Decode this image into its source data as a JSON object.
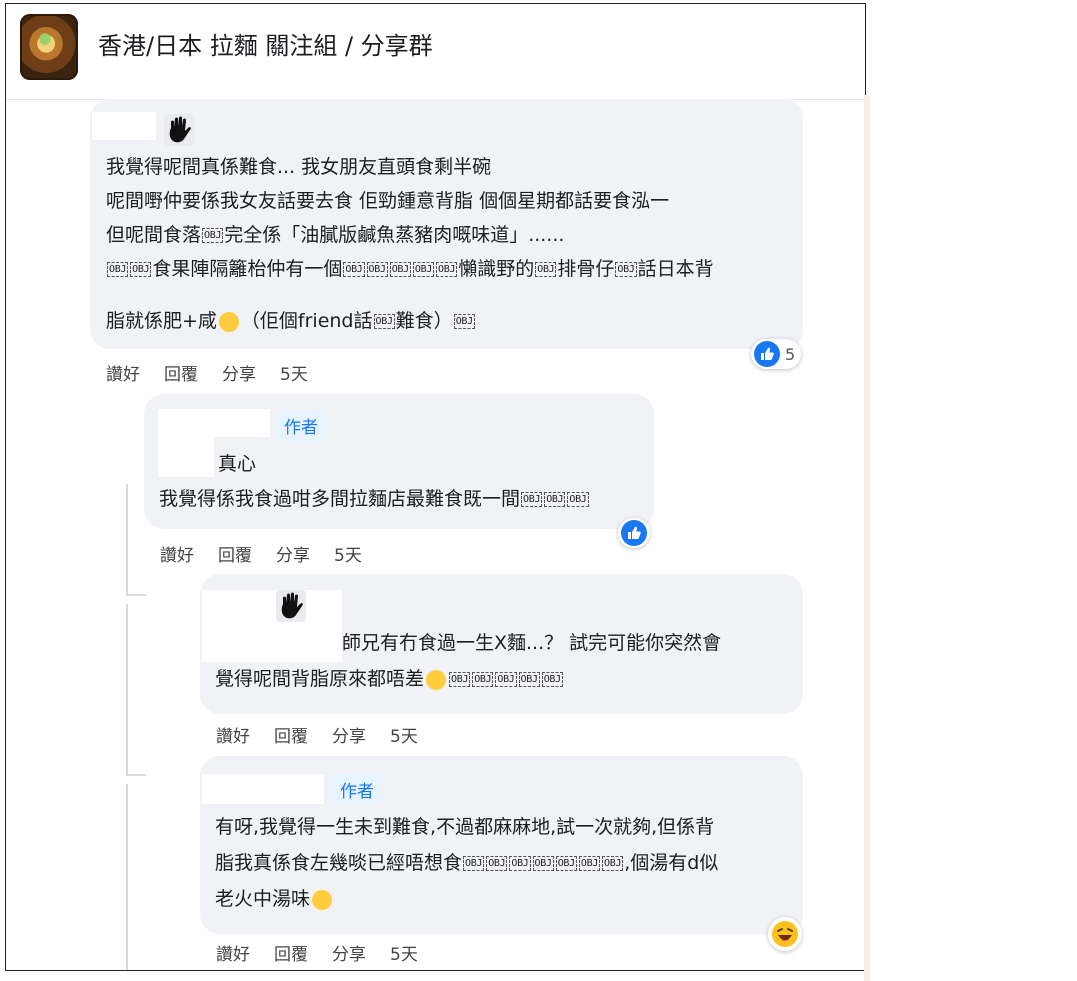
{
  "group": {
    "title": "香港/日本 拉麵 關注組 / 分享群"
  },
  "author_badge": "作者",
  "comments": [
    {
      "lines": [
        "我覺得呢間真係難食... 我女朋友直頭食剩半碗",
        "呢間嘢仲要係我女友話要去食 佢勁鍾意背脂 個個星期都話要食泓一",
        "但呢間食落",
        "完全係「油膩版鹹魚蒸豬肉嘅味道」......",
        "食果陣隔籬枱仲有一個",
        "懶識野的",
        "排骨仔",
        "話日本背",
        "脂就係肥+咸",
        "（佢個friend話",
        "難食）"
      ],
      "actions": [
        "讚好",
        "回覆",
        "分享",
        "5天"
      ],
      "reaction_count": "5"
    },
    {
      "lines": [
        "真心",
        "我覺得係我食過咁多間拉麵店最難食既一間"
      ],
      "actions": [
        "讚好",
        "回覆",
        "分享",
        "5天"
      ]
    },
    {
      "lines": [
        "師兄有冇食過一生X麵...？ 試完可能你突然會",
        "覺得呢間背脂原來都唔差"
      ],
      "actions": [
        "讚好",
        "回覆",
        "分享",
        "5天"
      ]
    },
    {
      "lines": [
        "有呀,我覺得一生未到難食,不過都麻麻地,試一次就夠,但係背",
        "脂我真係食左幾啖已經唔想食",
        ",個湯有d似",
        "老火中湯味"
      ],
      "actions": [
        "讚好",
        "回覆",
        "分享",
        "5天"
      ]
    }
  ],
  "obj_glyph": "OBJ",
  "icons": {
    "group_avatar": "ramen-bowl-avatar",
    "hand": "waving-hand-icon",
    "like": "thumbs-up-icon",
    "haha": "laughing-face-icon",
    "wry": "wry-face-icon",
    "crying_laugh": "crying-laughing-face-icon",
    "rofl": "rolling-laughing-face-icon"
  },
  "colors": {
    "accent": "#1877f2",
    "bubble": "#f0f2f5",
    "badge_bg": "#e7f3ff"
  }
}
